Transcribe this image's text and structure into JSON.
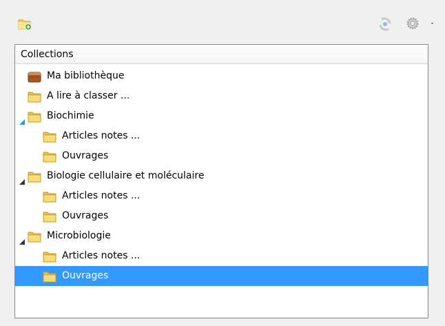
{
  "toolbar": {
    "new_collection_icon": "folder-add-icon",
    "sync_icon": "sync-icon",
    "actions_icon": "gear-icon"
  },
  "collections": {
    "header": "Collections",
    "items": [
      {
        "label": "Ma bibliothèque",
        "icon": "library-icon",
        "level": 0,
        "twisty": "none",
        "selected": false
      },
      {
        "label": "A lire à classer ...",
        "icon": "folder-icon",
        "level": 0,
        "twisty": "none",
        "selected": false
      },
      {
        "label": "Biochimie",
        "icon": "folder-icon",
        "level": 0,
        "twisty": "expanded-hover",
        "selected": false
      },
      {
        "label": "Articles notes ...",
        "icon": "folder-icon",
        "level": 1,
        "twisty": "none",
        "selected": false
      },
      {
        "label": "Ouvrages",
        "icon": "folder-icon",
        "level": 1,
        "twisty": "none",
        "selected": false
      },
      {
        "label": "Biologie cellulaire et moléculaire",
        "icon": "folder-icon",
        "level": 0,
        "twisty": "expanded",
        "selected": false
      },
      {
        "label": "Articles notes ...",
        "icon": "folder-icon",
        "level": 1,
        "twisty": "none",
        "selected": false
      },
      {
        "label": "Ouvrages",
        "icon": "folder-icon",
        "level": 1,
        "twisty": "none",
        "selected": false
      },
      {
        "label": "Microbiologie",
        "icon": "folder-icon",
        "level": 0,
        "twisty": "expanded",
        "selected": false
      },
      {
        "label": "Articles notes ...",
        "icon": "folder-icon",
        "level": 1,
        "twisty": "none",
        "selected": false
      },
      {
        "label": "Ouvrages",
        "icon": "folder-icon",
        "level": 1,
        "twisty": "none",
        "selected": true
      }
    ]
  },
  "colors": {
    "selection": "#3399ff",
    "folder": "#f6d365",
    "twisty_hover": "#1ba1e2"
  }
}
